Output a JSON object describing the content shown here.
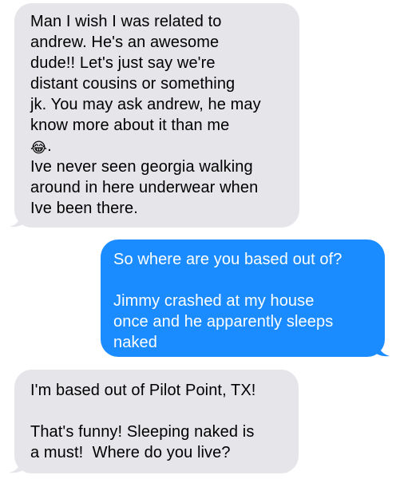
{
  "messages": [
    {
      "direction": "incoming",
      "lines": [
        "Man I wish I was related to",
        "andrew. He's an awesome",
        "dude!! Let's just say we're",
        "distant cousins or something",
        "jk. You may ask andrew, he may",
        "know more about it than me"
      ],
      "emoji_line_suffix": ".",
      "emoji": "😂",
      "emoji_name": "tears-of-joy-emoji",
      "lines_after": [
        "Ive never seen georgia walking",
        "around in here underwear when",
        "Ive been there."
      ]
    },
    {
      "direction": "outgoing",
      "paragraph1": [
        "So where are you based out of?"
      ],
      "paragraph2": [
        "Jimmy crashed at my house",
        "once and he apparently sleeps",
        "naked"
      ]
    },
    {
      "direction": "incoming",
      "paragraph1": [
        "I'm based out of Pilot Point, TX!"
      ],
      "paragraph2": [
        "That's funny! Sleeping naked is",
        "a must!  Where do you live?"
      ]
    }
  ],
  "colors": {
    "incoming_bg": "#e5e5ea",
    "outgoing_bg": "#1a8cff",
    "incoming_text": "#000000",
    "outgoing_text": "#ffffff"
  }
}
